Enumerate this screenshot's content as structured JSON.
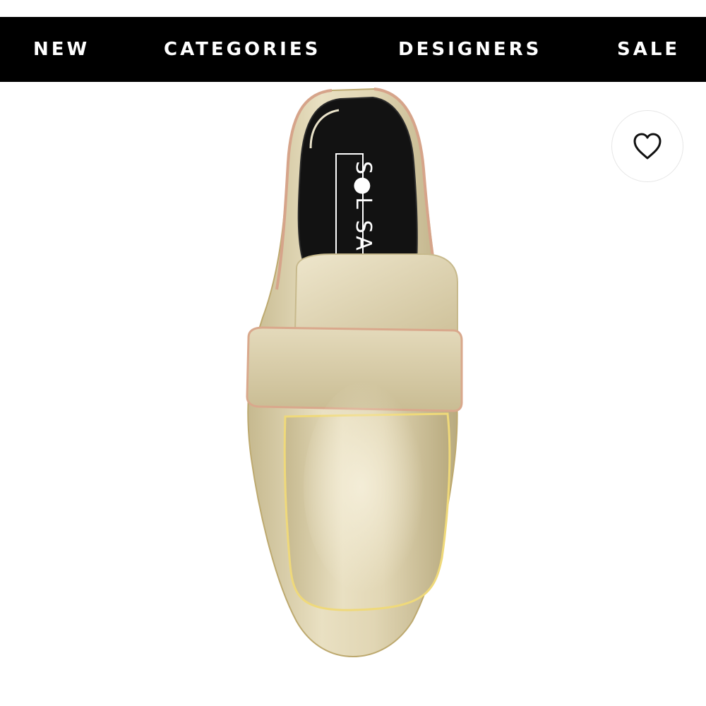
{
  "nav": {
    "items": [
      {
        "label": "NEW"
      },
      {
        "label": "CATEGORIES"
      },
      {
        "label": "DESIGNERS"
      },
      {
        "label": "SALE"
      }
    ]
  },
  "product": {
    "insole_brand": "S●L SAN"
  },
  "icons": {
    "wishlist": "heart-icon"
  },
  "colors": {
    "nav_background": "#000000",
    "nav_text": "#ffffff",
    "shoe_gold": "#d8cca4"
  }
}
